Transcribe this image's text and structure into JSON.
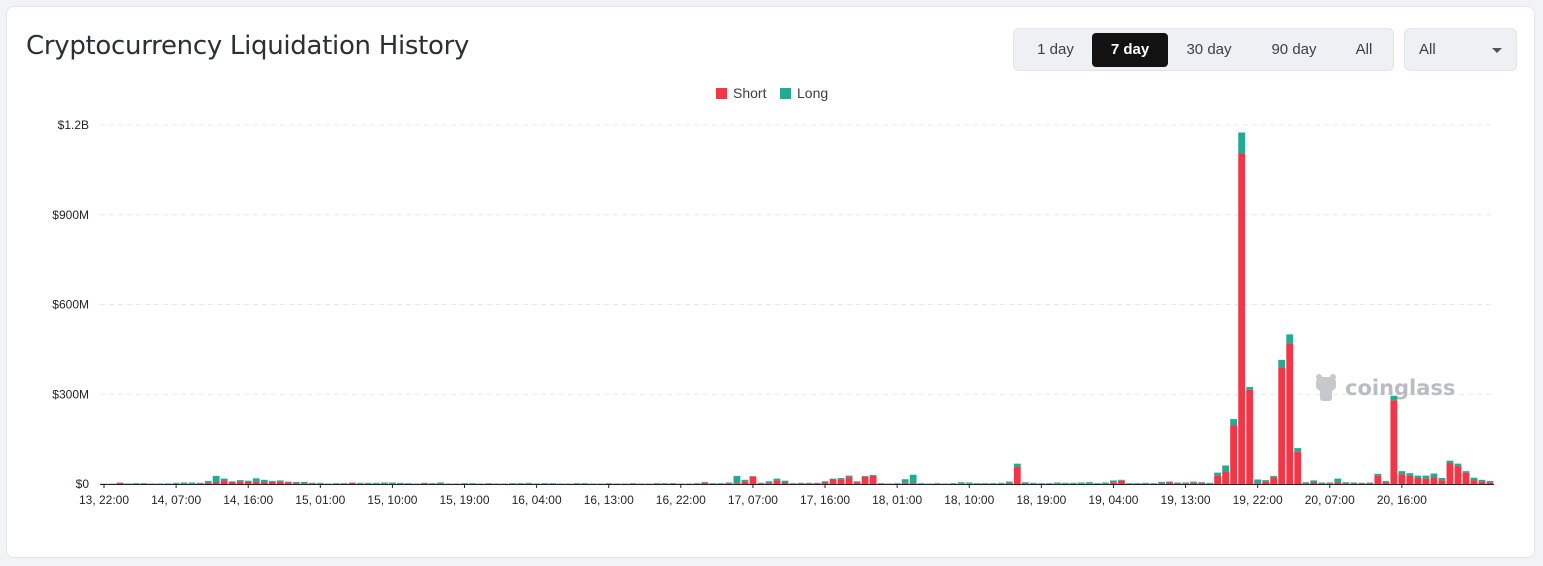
{
  "title": "Cryptocurrency Liquidation History",
  "range_buttons": [
    {
      "label": "1 day",
      "active": false
    },
    {
      "label": "7 day",
      "active": true
    },
    {
      "label": "30 day",
      "active": false
    },
    {
      "label": "90 day",
      "active": false
    },
    {
      "label": "All",
      "active": false
    }
  ],
  "select": {
    "value": "All"
  },
  "watermark": "coinglass",
  "colors": {
    "short": "#f23645",
    "long": "#22ab94"
  },
  "chart_data": {
    "type": "bar",
    "stacked": true,
    "legend": [
      "Short",
      "Long"
    ],
    "legend_position": "top-center",
    "grid": true,
    "ylim": [
      0,
      1200
    ],
    "y_unit": "M USD",
    "y_ticks": [
      {
        "value": 0,
        "label": "$0"
      },
      {
        "value": 300,
        "label": "$300M"
      },
      {
        "value": 600,
        "label": "$600M"
      },
      {
        "value": 900,
        "label": "$900M"
      },
      {
        "value": 1200,
        "label": "$1.2B"
      }
    ],
    "x_tick_labels": [
      "13, 22:00",
      "14, 07:00",
      "14, 16:00",
      "15, 01:00",
      "15, 10:00",
      "15, 19:00",
      "16, 04:00",
      "16, 13:00",
      "16, 22:00",
      "17, 07:00",
      "17, 16:00",
      "18, 01:00",
      "18, 10:00",
      "18, 19:00",
      "19, 04:00",
      "19, 13:00",
      "19, 22:00",
      "20, 07:00",
      "20, 16:00"
    ],
    "x_tick_step_hours": 9,
    "bar_interval_hours": 1,
    "series": [
      {
        "name": "Short",
        "values": [
          1,
          1,
          4,
          1,
          1,
          1,
          1,
          1,
          0,
          1,
          1,
          1,
          2,
          4,
          5,
          12,
          7,
          8,
          7,
          8,
          5,
          7,
          8,
          6,
          3,
          2,
          2,
          1,
          1,
          1,
          1,
          4,
          1,
          1,
          1,
          1,
          1,
          1,
          1,
          1,
          2,
          1,
          2,
          1,
          1,
          1,
          1,
          1,
          1,
          1,
          1,
          1,
          1,
          1,
          1,
          1,
          1,
          1,
          1,
          1,
          1,
          1,
          1,
          1,
          1,
          1,
          1,
          1,
          1,
          1,
          1,
          2,
          1,
          1,
          1,
          4,
          1,
          1,
          2,
          3,
          8,
          25,
          2,
          3,
          12,
          5,
          1,
          2,
          2,
          2,
          5,
          15,
          16,
          23,
          6,
          24,
          27,
          1,
          1,
          1,
          4,
          3,
          1,
          1,
          1,
          1,
          1,
          1,
          1,
          1,
          1,
          1,
          1,
          3,
          57,
          2,
          1,
          1,
          1,
          1,
          1,
          1,
          1,
          1,
          1,
          1,
          6,
          11,
          1,
          1,
          1,
          1,
          2,
          5,
          2,
          2,
          4,
          3,
          1,
          28,
          42,
          197,
          1105,
          315,
          3,
          8,
          22,
          390,
          470,
          108,
          2,
          5,
          2,
          2,
          5,
          2,
          2,
          2,
          2,
          28,
          6,
          280,
          33,
          28,
          20,
          18,
          23,
          12,
          70,
          60,
          38,
          13,
          8,
          6
        ]
      },
      {
        "name": "Long",
        "values": [
          0,
          0,
          1,
          1,
          2,
          2,
          1,
          1,
          2,
          3,
          4,
          4,
          2,
          6,
          22,
          6,
          2,
          5,
          4,
          11,
          9,
          3,
          4,
          2,
          4,
          5,
          2,
          3,
          1,
          2,
          2,
          1,
          3,
          3,
          3,
          4,
          4,
          3,
          2,
          1,
          2,
          2,
          3,
          1,
          1,
          2,
          2,
          1,
          2,
          1,
          1,
          2,
          2,
          3,
          1,
          2,
          2,
          1,
          1,
          2,
          2,
          1,
          1,
          2,
          1,
          1,
          2,
          1,
          1,
          2,
          2,
          1,
          1,
          1,
          2,
          3,
          2,
          2,
          3,
          24,
          6,
          1,
          2,
          6,
          6,
          6,
          2,
          2,
          2,
          2,
          4,
          3,
          4,
          5,
          3,
          3,
          3,
          2,
          1,
          2,
          12,
          28,
          2,
          1,
          2,
          1,
          2,
          5,
          4,
          2,
          2,
          2,
          3,
          5,
          11,
          4,
          3,
          2,
          2,
          4,
          3,
          3,
          4,
          5,
          2,
          4,
          6,
          3,
          2,
          2,
          3,
          2,
          5,
          3,
          3,
          3,
          4,
          3,
          3,
          10,
          20,
          20,
          70,
          9,
          12,
          5,
          5,
          25,
          30,
          12,
          4,
          7,
          3,
          3,
          13,
          4,
          3,
          2,
          3,
          6,
          4,
          15,
          10,
          8,
          8,
          10,
          12,
          8,
          8,
          8,
          5,
          8,
          6,
          4
        ]
      }
    ]
  }
}
